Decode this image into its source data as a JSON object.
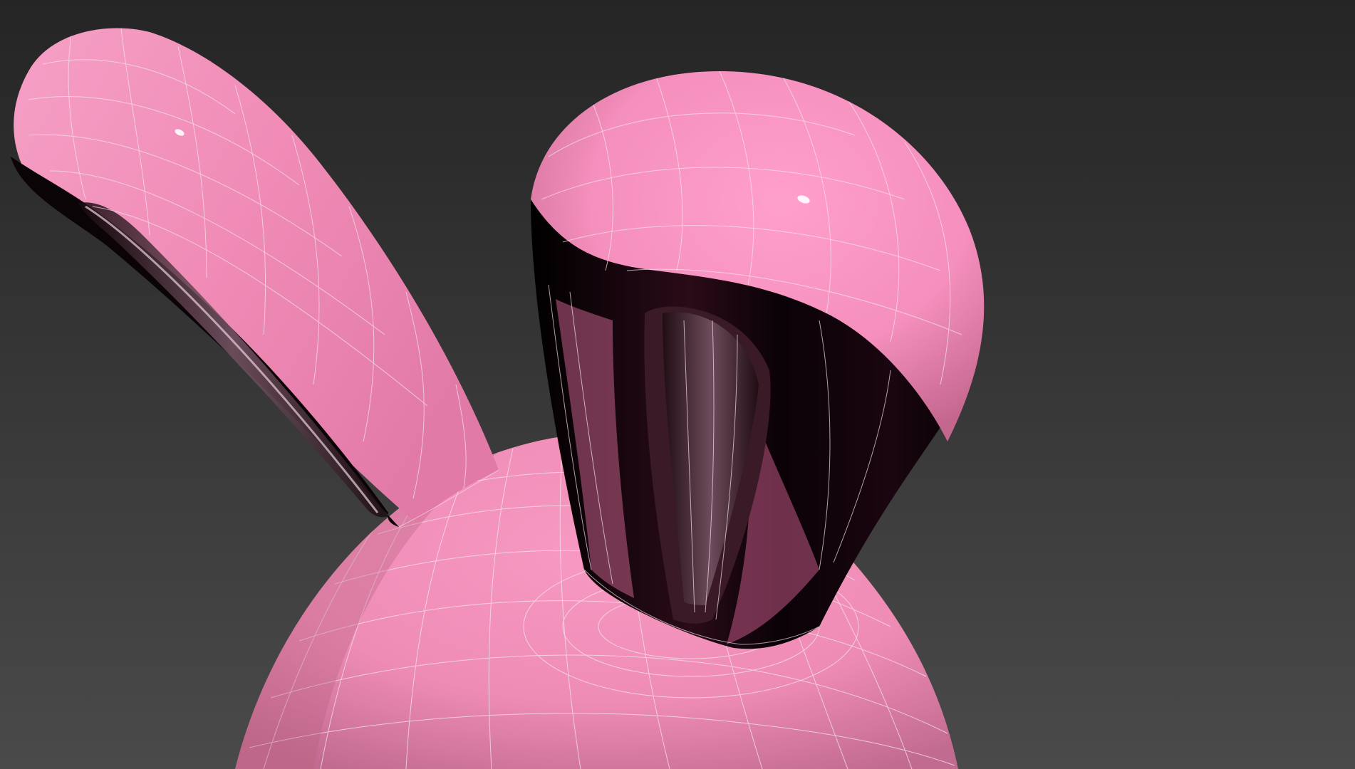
{
  "viewport": {
    "view": "perspective",
    "shading": "smooth-shaded-with-wireframe-edges",
    "background_gradient": [
      "#252525",
      "#3b3b3b",
      "#4a4a4a"
    ]
  },
  "model": {
    "subject": "bunny-head",
    "material_color": "#f08cb6",
    "material_highlight": "#ff9fcc",
    "material_shadow": "#b35f83",
    "inner_ear_color": "#0a0306",
    "wire_color": "#efefef"
  }
}
